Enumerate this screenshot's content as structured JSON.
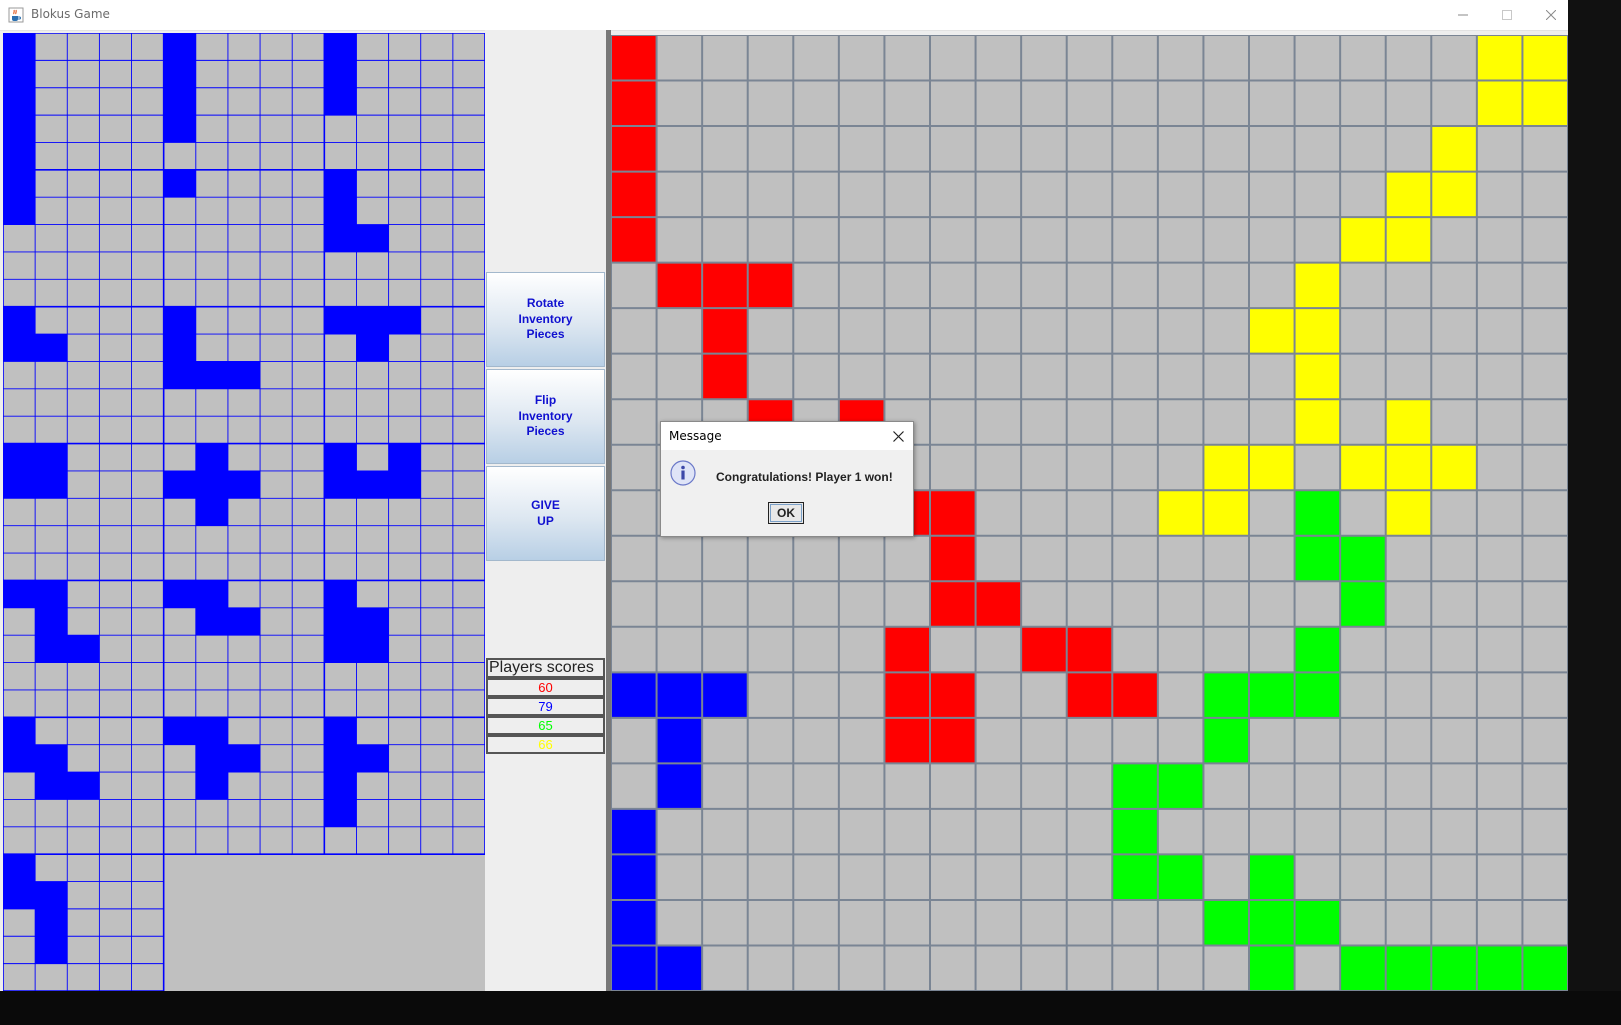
{
  "window": {
    "title": "Blokus Game",
    "icon": "java-cup-icon"
  },
  "controls": {
    "rotate": "Rotate\nInventory\nPieces",
    "flip": "Flip\nInventory\nPieces",
    "give_up": "GIVE\nUP"
  },
  "scores": {
    "title": "Players scores",
    "players": [
      {
        "value": "60",
        "color": "#ff0000"
      },
      {
        "value": "79",
        "color": "#0000ff"
      },
      {
        "value": "65",
        "color": "#00ff00"
      },
      {
        "value": "66",
        "color": "#ffff00"
      }
    ]
  },
  "dialog": {
    "title": "Message",
    "message": "Congratulations! Player 1 won!",
    "ok": "OK",
    "icon": "info-icon"
  },
  "colors": {
    "red": "#ff0000",
    "blue": "#0000ff",
    "green": "#00ff00",
    "yellow": "#ffff00",
    "empty": "#c0c0c0",
    "board_grid": "#7a8594",
    "inventory_grid": "#0000ff"
  },
  "board": {
    "size": 21,
    "cells": {
      "red": [
        [
          0,
          0
        ],
        [
          1,
          0
        ],
        [
          2,
          0
        ],
        [
          3,
          0
        ],
        [
          4,
          0
        ],
        [
          5,
          1
        ],
        [
          5,
          2
        ],
        [
          5,
          3
        ],
        [
          6,
          2
        ],
        [
          7,
          2
        ],
        [
          8,
          3
        ],
        [
          8,
          5
        ],
        [
          10,
          6
        ],
        [
          10,
          7
        ],
        [
          11,
          7
        ],
        [
          12,
          7
        ],
        [
          12,
          8
        ],
        [
          13,
          6
        ],
        [
          13,
          9
        ],
        [
          13,
          10
        ],
        [
          14,
          6
        ],
        [
          14,
          7
        ],
        [
          14,
          10
        ],
        [
          14,
          11
        ],
        [
          15,
          6
        ],
        [
          15,
          7
        ]
      ],
      "blue": [
        [
          14,
          0
        ],
        [
          14,
          1
        ],
        [
          14,
          2
        ],
        [
          15,
          1
        ],
        [
          16,
          1
        ],
        [
          17,
          0
        ],
        [
          18,
          0
        ],
        [
          19,
          0
        ],
        [
          20,
          0
        ],
        [
          20,
          1
        ]
      ],
      "yellow": [
        [
          0,
          19
        ],
        [
          0,
          20
        ],
        [
          1,
          19
        ],
        [
          1,
          20
        ],
        [
          2,
          18
        ],
        [
          3,
          17
        ],
        [
          3,
          18
        ],
        [
          4,
          16
        ],
        [
          4,
          17
        ],
        [
          5,
          15
        ],
        [
          6,
          14
        ],
        [
          6,
          15
        ],
        [
          7,
          15
        ],
        [
          8,
          15
        ],
        [
          8,
          17
        ],
        [
          9,
          13
        ],
        [
          9,
          14
        ],
        [
          9,
          16
        ],
        [
          9,
          17
        ],
        [
          9,
          18
        ],
        [
          10,
          12
        ],
        [
          10,
          13
        ],
        [
          10,
          17
        ]
      ],
      "green": [
        [
          10,
          15
        ],
        [
          11,
          15
        ],
        [
          11,
          16
        ],
        [
          12,
          16
        ],
        [
          13,
          15
        ],
        [
          14,
          13
        ],
        [
          14,
          14
        ],
        [
          14,
          15
        ],
        [
          15,
          13
        ],
        [
          16,
          11
        ],
        [
          16,
          12
        ],
        [
          17,
          11
        ],
        [
          18,
          11
        ],
        [
          18,
          12
        ],
        [
          18,
          14
        ],
        [
          19,
          13
        ],
        [
          19,
          14
        ],
        [
          19,
          15
        ],
        [
          20,
          14
        ],
        [
          20,
          16
        ],
        [
          20,
          17
        ],
        [
          20,
          18
        ],
        [
          20,
          19
        ],
        [
          20,
          20
        ]
      ]
    }
  },
  "inventory": {
    "cells": [
      [
        0,
        0
      ],
      [
        1,
        0
      ],
      [
        2,
        0
      ],
      [
        3,
        0
      ],
      [
        4,
        0
      ],
      [
        0,
        5
      ],
      [
        1,
        5
      ],
      [
        2,
        5
      ],
      [
        3,
        5
      ],
      [
        0,
        10
      ],
      [
        1,
        10
      ],
      [
        2,
        10
      ],
      [
        5,
        0
      ],
      [
        6,
        0
      ],
      [
        5,
        5
      ],
      [
        5,
        10
      ],
      [
        6,
        10
      ],
      [
        7,
        10
      ],
      [
        7,
        11
      ],
      [
        10,
        0
      ],
      [
        11,
        0
      ],
      [
        11,
        1
      ],
      [
        10,
        5
      ],
      [
        11,
        5
      ],
      [
        12,
        5
      ],
      [
        12,
        6
      ],
      [
        12,
        7
      ],
      [
        10,
        10
      ],
      [
        10,
        11
      ],
      [
        10,
        12
      ],
      [
        11,
        11
      ],
      [
        15,
        0
      ],
      [
        15,
        1
      ],
      [
        16,
        0
      ],
      [
        16,
        1
      ],
      [
        15,
        6
      ],
      [
        16,
        5
      ],
      [
        16,
        6
      ],
      [
        16,
        7
      ],
      [
        17,
        6
      ],
      [
        15,
        10
      ],
      [
        15,
        12
      ],
      [
        16,
        10
      ],
      [
        16,
        11
      ],
      [
        16,
        12
      ],
      [
        20,
        0
      ],
      [
        20,
        1
      ],
      [
        21,
        1
      ],
      [
        22,
        1
      ],
      [
        22,
        2
      ],
      [
        20,
        5
      ],
      [
        20,
        6
      ],
      [
        21,
        6
      ],
      [
        21,
        7
      ],
      [
        20,
        10
      ],
      [
        21,
        10
      ],
      [
        21,
        11
      ],
      [
        22,
        10
      ],
      [
        22,
        11
      ],
      [
        25,
        0
      ],
      [
        26,
        0
      ],
      [
        26,
        1
      ],
      [
        27,
        1
      ],
      [
        27,
        2
      ],
      [
        25,
        5
      ],
      [
        25,
        6
      ],
      [
        26,
        6
      ],
      [
        26,
        7
      ],
      [
        27,
        6
      ],
      [
        25,
        10
      ],
      [
        26,
        10
      ],
      [
        26,
        11
      ],
      [
        27,
        10
      ],
      [
        28,
        10
      ],
      [
        30,
        0
      ],
      [
        31,
        0
      ],
      [
        31,
        1
      ],
      [
        32,
        1
      ],
      [
        33,
        1
      ]
    ]
  }
}
